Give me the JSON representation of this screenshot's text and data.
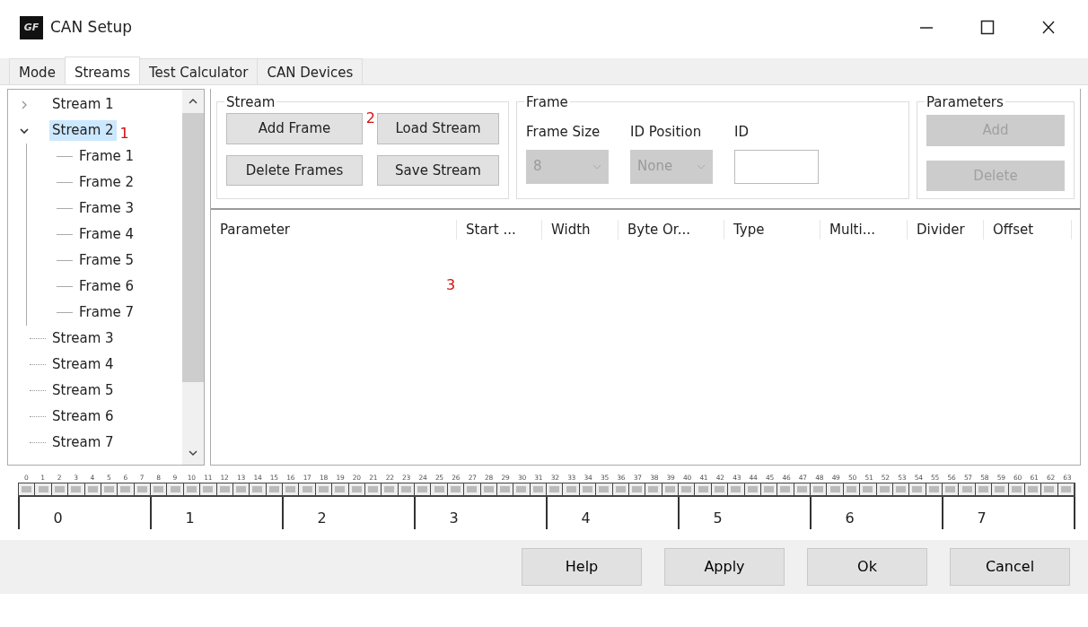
{
  "window": {
    "title": "CAN Setup",
    "logo_text": "GF"
  },
  "tabs": [
    {
      "label": "Mode",
      "selected": false
    },
    {
      "label": "Streams",
      "selected": true
    },
    {
      "label": "Test Calculator",
      "selected": false
    },
    {
      "label": "CAN Devices",
      "selected": false
    }
  ],
  "tree": [
    {
      "label": "Stream 1",
      "expanded": false,
      "selected": false
    },
    {
      "label": "Stream 2",
      "expanded": true,
      "selected": true,
      "annotation": "1",
      "children": [
        {
          "label": "Frame 1"
        },
        {
          "label": "Frame 2"
        },
        {
          "label": "Frame 3"
        },
        {
          "label": "Frame 4"
        },
        {
          "label": "Frame 5"
        },
        {
          "label": "Frame 6"
        },
        {
          "label": "Frame 7"
        }
      ]
    },
    {
      "label": "Stream 3",
      "selected": false
    },
    {
      "label": "Stream 4",
      "selected": false
    },
    {
      "label": "Stream 5",
      "selected": false
    },
    {
      "label": "Stream 6",
      "selected": false
    },
    {
      "label": "Stream 7",
      "selected": false
    }
  ],
  "stream_group": {
    "title": "Stream",
    "buttons": [
      {
        "label": "Add Frame",
        "disabled": false,
        "annotation": "2"
      },
      {
        "label": "Load Stream",
        "disabled": false
      },
      {
        "label": "Delete Frames",
        "disabled": false
      },
      {
        "label": "Save Stream",
        "disabled": false
      }
    ]
  },
  "frame_group": {
    "title": "Frame",
    "frame_size": {
      "label": "Frame Size",
      "value": "8",
      "disabled": true
    },
    "id_position": {
      "label": "ID Position",
      "value": "None",
      "disabled": true
    },
    "id": {
      "label": "ID"
    }
  },
  "parameters_group": {
    "title": "Parameters",
    "buttons": [
      {
        "label": "Add",
        "disabled": true
      },
      {
        "label": "Delete",
        "disabled": true
      }
    ]
  },
  "table": {
    "columns": [
      "Parameter",
      "Start ...",
      "Width",
      "Byte Or...",
      "Type",
      "Multi...",
      "Divider",
      "Offset"
    ],
    "annotation": "3"
  },
  "bit_layout": {
    "bits": [
      "0",
      "1",
      "2",
      "3",
      "4",
      "5",
      "6",
      "7",
      "8",
      "9",
      "10",
      "11",
      "12",
      "13",
      "14",
      "15",
      "16",
      "17",
      "18",
      "19",
      "20",
      "21",
      "22",
      "23",
      "24",
      "25",
      "26",
      "27",
      "28",
      "29",
      "30",
      "31",
      "32",
      "33",
      "34",
      "35",
      "36",
      "37",
      "38",
      "39",
      "40",
      "41",
      "42",
      "43",
      "44",
      "45",
      "46",
      "47",
      "48",
      "49",
      "50",
      "51",
      "52",
      "53",
      "54",
      "55",
      "56",
      "57",
      "58",
      "59",
      "60",
      "61",
      "62",
      "63"
    ],
    "bytes": [
      "0",
      "1",
      "2",
      "3",
      "4",
      "5",
      "6",
      "7"
    ]
  },
  "footer_buttons": [
    "Help",
    "Apply",
    "Ok",
    "Cancel"
  ]
}
